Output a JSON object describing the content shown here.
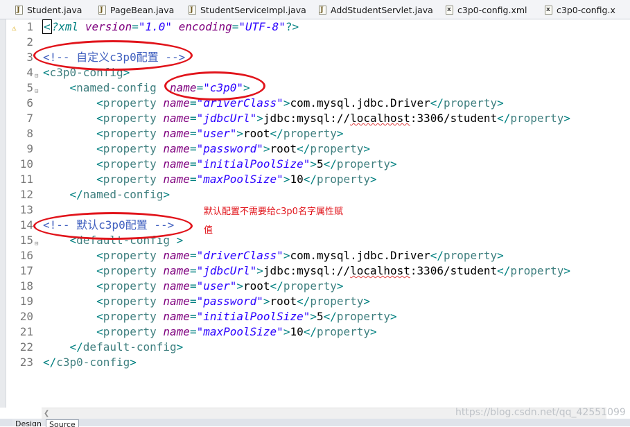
{
  "tabs": [
    {
      "label": "Student.java",
      "icon": "java-file-icon",
      "glyph": "J"
    },
    {
      "label": "PageBean.java",
      "icon": "java-file-icon",
      "glyph": "J"
    },
    {
      "label": "StudentServiceImpl.java",
      "icon": "java-file-icon",
      "glyph": "J"
    },
    {
      "label": "AddStudentServlet.java",
      "icon": "java-file-icon",
      "glyph": "J"
    },
    {
      "label": "c3p0-config.xml",
      "icon": "xml-file-icon",
      "glyph": "x"
    },
    {
      "label": "c3p0-config.x",
      "icon": "xml-file-icon",
      "glyph": "x"
    }
  ],
  "editor": {
    "lines": [
      {
        "num": "1",
        "indent": "",
        "warning": true,
        "tokens": [
          [
            "punct",
            "<"
          ],
          [
            "pi",
            "?xml "
          ],
          [
            "attr",
            "version"
          ],
          [
            "punct",
            "="
          ],
          [
            "value",
            "\"1.0\""
          ],
          [
            "pi",
            " "
          ],
          [
            "attr",
            "encoding"
          ],
          [
            "punct",
            "="
          ],
          [
            "value",
            "\"UTF-8\""
          ],
          [
            "punct",
            "?>"
          ]
        ]
      },
      {
        "num": "2",
        "indent": "",
        "tokens": []
      },
      {
        "num": "3",
        "indent": "",
        "tokens": [
          [
            "comment",
            "<!-- 自定义c3p0配置 -->"
          ]
        ]
      },
      {
        "num": "4",
        "indent": "",
        "fold": true,
        "tokens": [
          [
            "punct",
            "<"
          ],
          [
            "tagname",
            "c3p0-config"
          ],
          [
            "punct",
            ">"
          ]
        ]
      },
      {
        "num": "5",
        "indent": "    ",
        "fold": true,
        "tokens": [
          [
            "punct",
            "<"
          ],
          [
            "tagname",
            "named-config"
          ],
          [
            "text",
            "  "
          ],
          [
            "attr",
            "name"
          ],
          [
            "punct",
            "="
          ],
          [
            "value",
            "\"c3p0\""
          ],
          [
            "punct",
            ">"
          ]
        ]
      },
      {
        "num": "6",
        "indent": "        ",
        "tokens": [
          [
            "punct",
            "<"
          ],
          [
            "tagname",
            "property"
          ],
          [
            "text",
            " "
          ],
          [
            "attr",
            "name"
          ],
          [
            "punct",
            "="
          ],
          [
            "value",
            "\"driverClass\""
          ],
          [
            "punct",
            ">"
          ],
          [
            "text",
            "com.mysql.jdbc.Driver"
          ],
          [
            "punct",
            "</"
          ],
          [
            "tagname",
            "property"
          ],
          [
            "punct",
            ">"
          ]
        ]
      },
      {
        "num": "7",
        "indent": "        ",
        "tokens": [
          [
            "punct",
            "<"
          ],
          [
            "tagname",
            "property"
          ],
          [
            "text",
            " "
          ],
          [
            "attr",
            "name"
          ],
          [
            "punct",
            "="
          ],
          [
            "value",
            "\"jdbcUrl\""
          ],
          [
            "punct",
            ">"
          ],
          [
            "text",
            "jdbc:mysql://"
          ],
          [
            "squig",
            "localhost"
          ],
          [
            "text",
            ":3306/student"
          ],
          [
            "punct",
            "</"
          ],
          [
            "tagname",
            "property"
          ],
          [
            "punct",
            ">"
          ]
        ]
      },
      {
        "num": "8",
        "indent": "        ",
        "tokens": [
          [
            "punct",
            "<"
          ],
          [
            "tagname",
            "property"
          ],
          [
            "text",
            " "
          ],
          [
            "attr",
            "name"
          ],
          [
            "punct",
            "="
          ],
          [
            "value",
            "\"user\""
          ],
          [
            "punct",
            ">"
          ],
          [
            "text",
            "root"
          ],
          [
            "punct",
            "</"
          ],
          [
            "tagname",
            "property"
          ],
          [
            "punct",
            ">"
          ]
        ]
      },
      {
        "num": "9",
        "indent": "        ",
        "tokens": [
          [
            "punct",
            "<"
          ],
          [
            "tagname",
            "property"
          ],
          [
            "text",
            " "
          ],
          [
            "attr",
            "name"
          ],
          [
            "punct",
            "="
          ],
          [
            "value",
            "\"password\""
          ],
          [
            "punct",
            ">"
          ],
          [
            "text",
            "root"
          ],
          [
            "punct",
            "</"
          ],
          [
            "tagname",
            "property"
          ],
          [
            "punct",
            ">"
          ]
        ]
      },
      {
        "num": "10",
        "indent": "        ",
        "tokens": [
          [
            "punct",
            "<"
          ],
          [
            "tagname",
            "property"
          ],
          [
            "text",
            " "
          ],
          [
            "attr",
            "name"
          ],
          [
            "punct",
            "="
          ],
          [
            "value",
            "\"initialPoolSize\""
          ],
          [
            "punct",
            ">"
          ],
          [
            "text",
            "5"
          ],
          [
            "punct",
            "</"
          ],
          [
            "tagname",
            "property"
          ],
          [
            "punct",
            ">"
          ]
        ]
      },
      {
        "num": "11",
        "indent": "        ",
        "tokens": [
          [
            "punct",
            "<"
          ],
          [
            "tagname",
            "property"
          ],
          [
            "text",
            " "
          ],
          [
            "attr",
            "name"
          ],
          [
            "punct",
            "="
          ],
          [
            "value",
            "\"maxPoolSize\""
          ],
          [
            "punct",
            ">"
          ],
          [
            "text",
            "10"
          ],
          [
            "punct",
            "</"
          ],
          [
            "tagname",
            "property"
          ],
          [
            "punct",
            ">"
          ]
        ]
      },
      {
        "num": "12",
        "indent": "    ",
        "tokens": [
          [
            "punct",
            "</"
          ],
          [
            "tagname",
            "named-config"
          ],
          [
            "punct",
            ">"
          ]
        ]
      },
      {
        "num": "13",
        "indent": "",
        "tokens": []
      },
      {
        "num": "14",
        "indent": "",
        "tokens": [
          [
            "comment",
            "<!-- 默认c3p0配置 -->"
          ]
        ]
      },
      {
        "num": "15",
        "indent": "    ",
        "fold": true,
        "tokens": [
          [
            "punct",
            "<"
          ],
          [
            "tagname",
            "default-config"
          ],
          [
            "text",
            " "
          ],
          [
            "punct",
            ">"
          ]
        ]
      },
      {
        "num": "16",
        "indent": "        ",
        "tokens": [
          [
            "punct",
            "<"
          ],
          [
            "tagname",
            "property"
          ],
          [
            "text",
            " "
          ],
          [
            "attr",
            "name"
          ],
          [
            "punct",
            "="
          ],
          [
            "value",
            "\"driverClass\""
          ],
          [
            "punct",
            ">"
          ],
          [
            "text",
            "com.mysql.jdbc.Driver"
          ],
          [
            "punct",
            "</"
          ],
          [
            "tagname",
            "property"
          ],
          [
            "punct",
            ">"
          ]
        ]
      },
      {
        "num": "17",
        "indent": "        ",
        "tokens": [
          [
            "punct",
            "<"
          ],
          [
            "tagname",
            "property"
          ],
          [
            "text",
            " "
          ],
          [
            "attr",
            "name"
          ],
          [
            "punct",
            "="
          ],
          [
            "value",
            "\"jdbcUrl\""
          ],
          [
            "punct",
            ">"
          ],
          [
            "text",
            "jdbc:mysql://"
          ],
          [
            "squig",
            "localhost"
          ],
          [
            "text",
            ":3306/student"
          ],
          [
            "punct",
            "</"
          ],
          [
            "tagname",
            "property"
          ],
          [
            "punct",
            ">"
          ]
        ]
      },
      {
        "num": "18",
        "indent": "        ",
        "tokens": [
          [
            "punct",
            "<"
          ],
          [
            "tagname",
            "property"
          ],
          [
            "text",
            " "
          ],
          [
            "attr",
            "name"
          ],
          [
            "punct",
            "="
          ],
          [
            "value",
            "\"user\""
          ],
          [
            "punct",
            ">"
          ],
          [
            "text",
            "root"
          ],
          [
            "punct",
            "</"
          ],
          [
            "tagname",
            "property"
          ],
          [
            "punct",
            ">"
          ]
        ]
      },
      {
        "num": "19",
        "indent": "        ",
        "tokens": [
          [
            "punct",
            "<"
          ],
          [
            "tagname",
            "property"
          ],
          [
            "text",
            " "
          ],
          [
            "attr",
            "name"
          ],
          [
            "punct",
            "="
          ],
          [
            "value",
            "\"password\""
          ],
          [
            "punct",
            ">"
          ],
          [
            "text",
            "root"
          ],
          [
            "punct",
            "</"
          ],
          [
            "tagname",
            "property"
          ],
          [
            "punct",
            ">"
          ]
        ]
      },
      {
        "num": "20",
        "indent": "        ",
        "tokens": [
          [
            "punct",
            "<"
          ],
          [
            "tagname",
            "property"
          ],
          [
            "text",
            " "
          ],
          [
            "attr",
            "name"
          ],
          [
            "punct",
            "="
          ],
          [
            "value",
            "\"initialPoolSize\""
          ],
          [
            "punct",
            ">"
          ],
          [
            "text",
            "5"
          ],
          [
            "punct",
            "</"
          ],
          [
            "tagname",
            "property"
          ],
          [
            "punct",
            ">"
          ]
        ]
      },
      {
        "num": "21",
        "indent": "        ",
        "tokens": [
          [
            "punct",
            "<"
          ],
          [
            "tagname",
            "property"
          ],
          [
            "text",
            " "
          ],
          [
            "attr",
            "name"
          ],
          [
            "punct",
            "="
          ],
          [
            "value",
            "\"maxPoolSize\""
          ],
          [
            "punct",
            ">"
          ],
          [
            "text",
            "10"
          ],
          [
            "punct",
            "</"
          ],
          [
            "tagname",
            "property"
          ],
          [
            "punct",
            ">"
          ]
        ]
      },
      {
        "num": "22",
        "indent": "    ",
        "tokens": [
          [
            "punct",
            "</"
          ],
          [
            "tagname",
            "default-config"
          ],
          [
            "punct",
            ">"
          ]
        ]
      },
      {
        "num": "23",
        "indent": "",
        "tokens": [
          [
            "punct",
            "</"
          ],
          [
            "tagname",
            "c3p0-config"
          ],
          [
            "punct",
            ">"
          ]
        ]
      }
    ]
  },
  "annotation": {
    "note_line1": "默认配置不需要给c3p0名字属性赋",
    "note_line2": "值",
    "color": "#e1141b"
  },
  "bottom_tabs": {
    "design": "Design",
    "source": "Source"
  },
  "watermark": "https://blog.csdn.net/qq_42551099"
}
